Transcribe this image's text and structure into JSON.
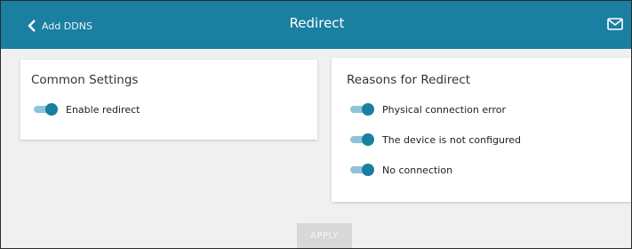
{
  "header": {
    "back_label": "Add DDNS",
    "title": "Redirect"
  },
  "colors": {
    "header_bg": "#1a7fa0",
    "toggle_on": "#1a7fa0",
    "toggle_track": "#8fc4d8",
    "page_bg": "#f0f0f0"
  },
  "common_settings": {
    "title": "Common Settings",
    "toggles": [
      {
        "label": "Enable redirect",
        "on": true
      }
    ]
  },
  "reasons": {
    "title": "Reasons for Redirect",
    "toggles": [
      {
        "label": "Physical connection error",
        "on": true
      },
      {
        "label": "The device is not configured",
        "on": true
      },
      {
        "label": "No connection",
        "on": true
      }
    ]
  },
  "footer": {
    "apply_label": "APPLY"
  }
}
